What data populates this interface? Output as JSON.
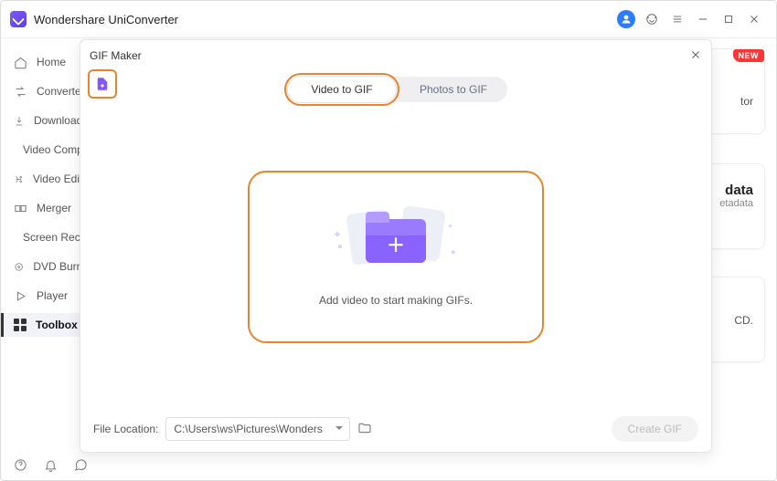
{
  "app": {
    "title": "Wondershare UniConverter"
  },
  "sidebar": {
    "items": [
      {
        "label": "Home"
      },
      {
        "label": "Converter"
      },
      {
        "label": "Downloader"
      },
      {
        "label": "Video Compressor"
      },
      {
        "label": "Video Editor"
      },
      {
        "label": "Merger"
      },
      {
        "label": "Screen Recorder"
      },
      {
        "label": "DVD Burner"
      },
      {
        "label": "Player"
      },
      {
        "label": "Toolbox"
      }
    ]
  },
  "bg": {
    "new_badge": "NEW",
    "card1_suffix": "tor",
    "card2_title_suffix": "data",
    "card2_sub_suffix": "etadata",
    "card3_suffix": "CD."
  },
  "modal": {
    "title": "GIF Maker",
    "tabs": {
      "video": "Video to GIF",
      "photos": "Photos to GIF"
    },
    "drop_text": "Add video to start making GIFs.",
    "file_location_label": "File Location:",
    "file_location_value": "C:\\Users\\ws\\Pictures\\Wonders",
    "create_label": "Create GIF"
  }
}
